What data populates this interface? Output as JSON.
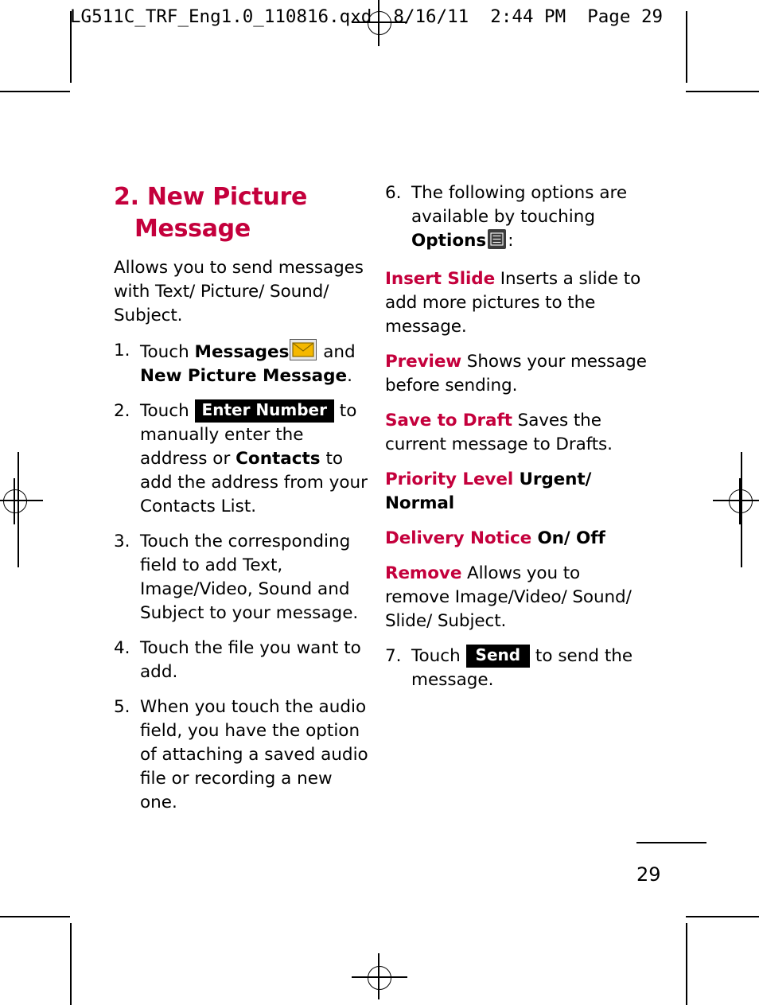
{
  "print_header": "LG511C_TRF_Eng1.0_110816.qxd  8/16/11  2:44 PM  Page 29",
  "page_number": "29",
  "left_column": {
    "heading_line1": "2. New Picture",
    "heading_line2": "Message",
    "intro": "Allows you to send messages with Text/ Picture/ Sound/ Subject.",
    "steps": [
      {
        "num": "1.",
        "pre": "Touch ",
        "bold1": "Messages",
        "icon": "envelope-icon",
        "mid": " and ",
        "bold2": "New Picture Message",
        "post": "."
      },
      {
        "num": "2.",
        "pre": "Touch ",
        "chip": "Enter Number",
        "mid": " to manually enter the address or ",
        "bold": "Contacts",
        "post": " to add the address from your Contacts List."
      },
      {
        "num": "3.",
        "text": "Touch the corresponding field  to add Text, Image/Video, Sound and Subject to your message."
      },
      {
        "num": "4.",
        "text": "Touch the file you want to add."
      },
      {
        "num": "5.",
        "text": "When you touch the audio field, you have the option of attaching a saved audio file or recording a new one."
      }
    ]
  },
  "right_column": {
    "step6": {
      "num": "6.",
      "pre": "The following options are available by touching ",
      "bold": "Options",
      "icon": "list-menu-icon",
      "post": ":"
    },
    "options": [
      {
        "term": "Insert Slide",
        "desc": " Inserts a slide to add more pictures to the message."
      },
      {
        "term": "Preview",
        "desc": " Shows your message before sending."
      },
      {
        "term": "Save to Draft",
        "desc": " Saves the current message to Drafts."
      },
      {
        "term": "Priority Level",
        "desc": " Urgent/ Normal"
      },
      {
        "term": "Delivery Notice",
        "desc": " On/ Off"
      },
      {
        "term": "Remove",
        "desc": " Allows you to remove Image/Video/ Sound/ Slide/ Subject."
      }
    ],
    "step7": {
      "num": "7.",
      "pre": "Touch ",
      "chip": "Send",
      "post": " to send the message."
    }
  },
  "colors": {
    "accent": "#c4003c",
    "text": "#000000",
    "chip_background": "#000000"
  }
}
